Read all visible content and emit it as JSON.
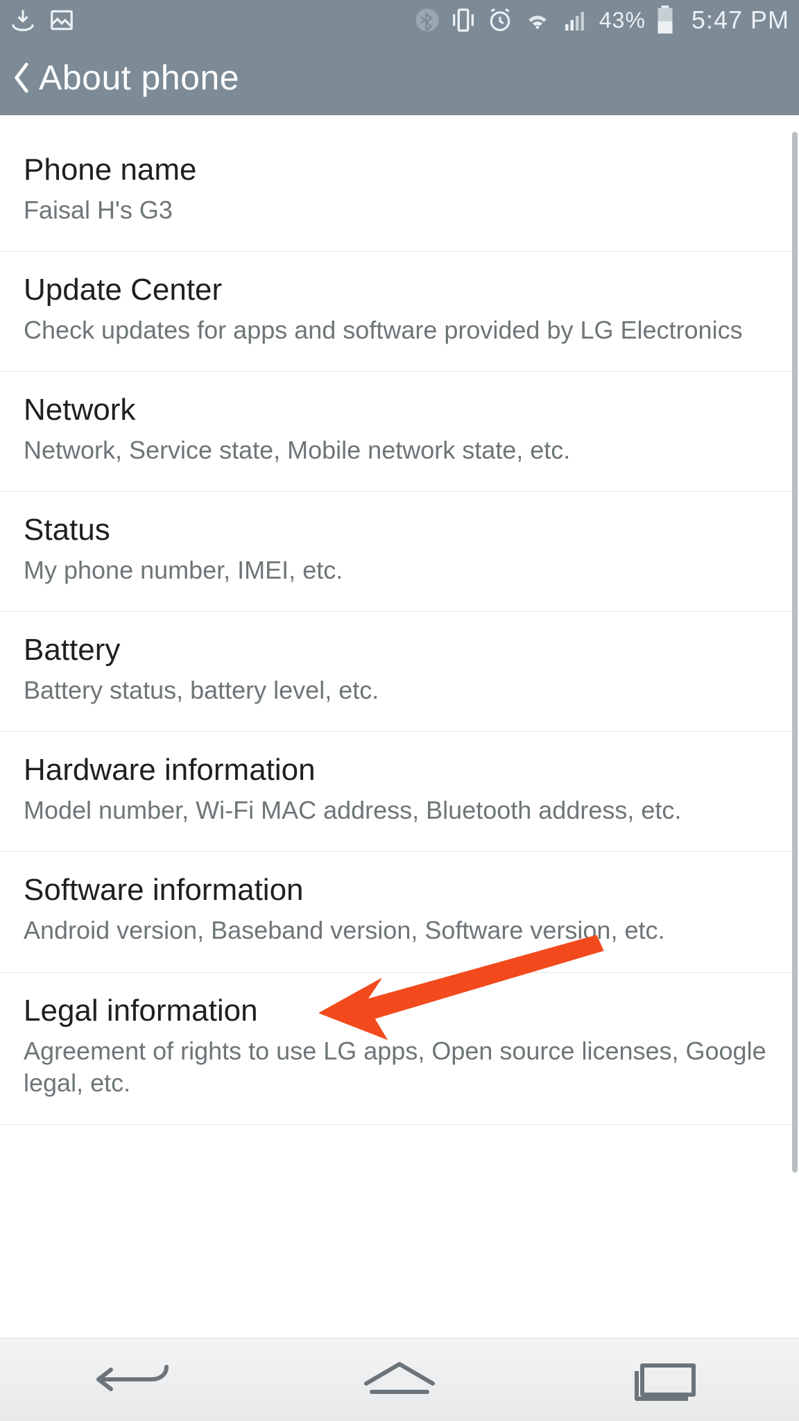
{
  "status": {
    "battery_percent": "43%",
    "time": "5:47 PM"
  },
  "header": {
    "title": "About phone"
  },
  "items": [
    {
      "title": "Phone name",
      "sub": "Faisal H's G3"
    },
    {
      "title": "Update Center",
      "sub": "Check updates for apps and software provided by LG Electronics"
    },
    {
      "title": "Network",
      "sub": "Network, Service state, Mobile network state, etc."
    },
    {
      "title": "Status",
      "sub": "My phone number, IMEI, etc."
    },
    {
      "title": "Battery",
      "sub": "Battery status, battery level, etc."
    },
    {
      "title": "Hardware information",
      "sub": "Model number, Wi-Fi MAC address, Bluetooth address, etc."
    },
    {
      "title": "Software information",
      "sub": "Android version, Baseband version, Software version, etc."
    },
    {
      "title": "Legal information",
      "sub": "Agreement of rights to use LG apps, Open source licenses, Google legal, etc."
    }
  ],
  "annotation": {
    "target_item_index": 6
  }
}
